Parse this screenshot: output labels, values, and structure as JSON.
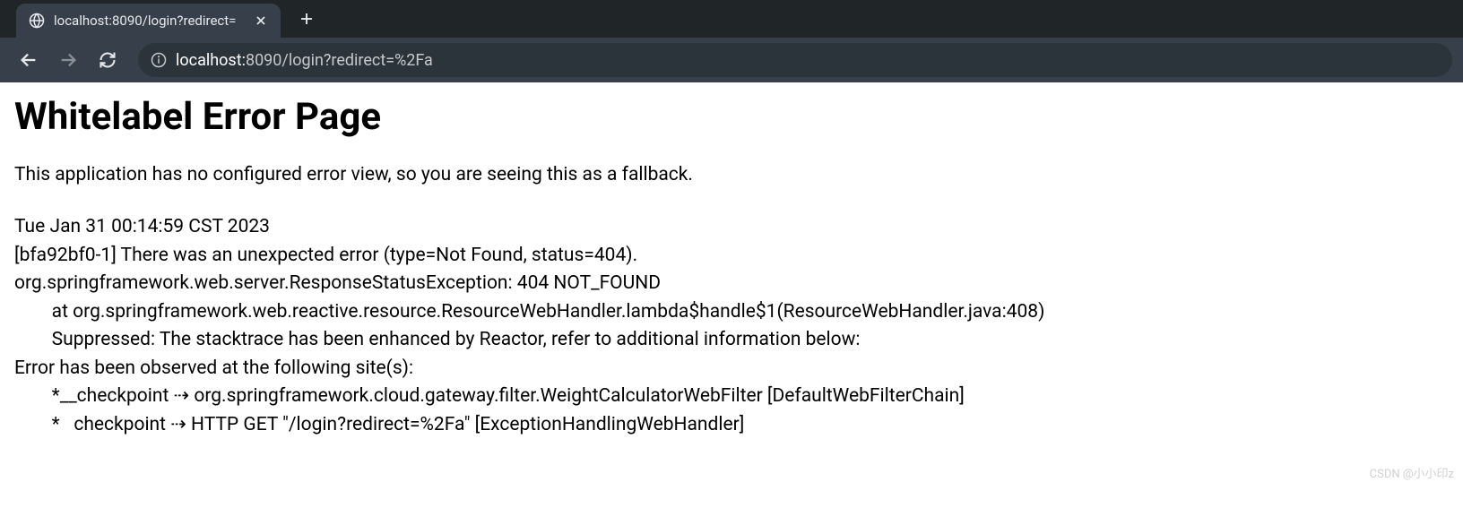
{
  "browser": {
    "tab_title": "localhost:8090/login?redirect=",
    "url_prefix": "localhost:",
    "url_rest": "8090/login?redirect=%2Fa"
  },
  "page": {
    "heading": "Whitelabel Error Page",
    "subheading": "This application has no configured error view, so you are seeing this as a fallback.",
    "timestamp": "Tue Jan 31 00:14:59 CST 2023",
    "error_line": "[bfa92bf0-1] There was an unexpected error (type=Not Found, status=404).",
    "exception_line": "org.springframework.web.server.ResponseStatusException: 404 NOT_FOUND",
    "at_line": "\tat org.springframework.web.reactive.resource.ResourceWebHandler.lambda$handle$1(ResourceWebHandler.java:408)",
    "suppressed_line": "\tSuppressed: The stacktrace has been enhanced by Reactor, refer to additional information below:",
    "observed_line": "Error has been observed at the following site(s):",
    "checkpoint1": "\t*__checkpoint ⇢ org.springframework.cloud.gateway.filter.WeightCalculatorWebFilter [DefaultWebFilterChain]",
    "checkpoint2": "\t*   checkpoint ⇢ HTTP GET \"/login?redirect=%2Fa\" [ExceptionHandlingWebHandler]"
  },
  "watermark": "CSDN @小小印z"
}
